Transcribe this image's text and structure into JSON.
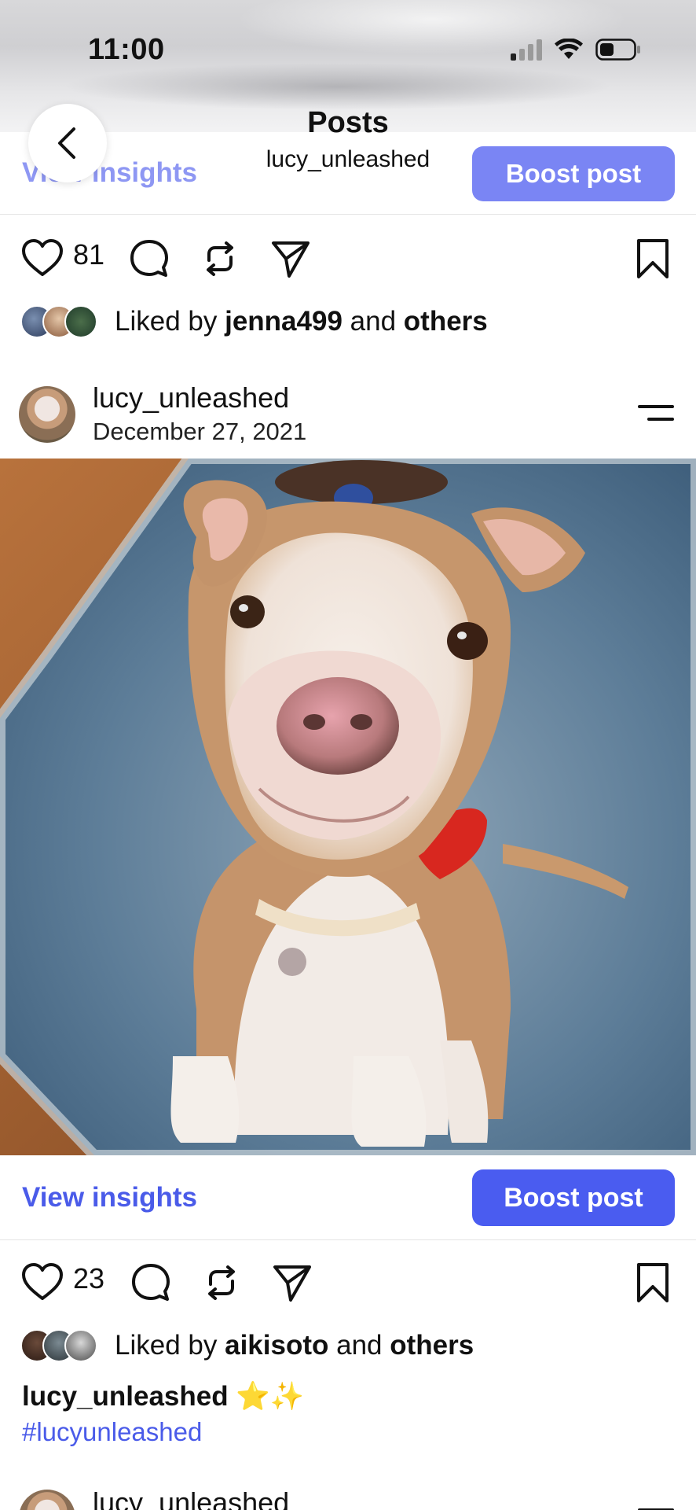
{
  "status_bar": {
    "time": "11:00",
    "icons": [
      "cellular-signal-icon",
      "wifi-icon",
      "battery-icon"
    ]
  },
  "header": {
    "title": "Posts",
    "subtitle": "lucy_unleashed",
    "back_icon": "chevron-left-icon"
  },
  "previous_post": {
    "view_insights_label": "View insights",
    "boost_label": "Boost post",
    "like_count": "81",
    "liked_by_prefix": "Liked by",
    "liked_by_user": "jenna499",
    "liked_by_and": "and",
    "liked_by_others": "others"
  },
  "post": {
    "username": "lucy_unleashed",
    "date": "December 27, 2021",
    "menu_icon": "more-options-icon",
    "view_insights_label": "View insights",
    "boost_label": "Boost post",
    "like_count": "23",
    "liked_by_prefix": "Liked by",
    "liked_by_user": "aikisoto",
    "liked_by_and": "and",
    "liked_by_others": "others",
    "caption_user": "lucy_unleashed",
    "caption_emoji": "⭐✨",
    "hashtag": "#lucyunleashed"
  },
  "next_post": {
    "username": "lucy_unleashed"
  },
  "icons": {
    "like": "heart-icon",
    "comment": "comment-icon",
    "repost": "repost-icon",
    "share": "send-icon",
    "save": "bookmark-icon"
  },
  "colors": {
    "accent": "#4a5cf0",
    "link": "#4a5be9",
    "text": "#111111",
    "divider": "#e4e4e4"
  }
}
